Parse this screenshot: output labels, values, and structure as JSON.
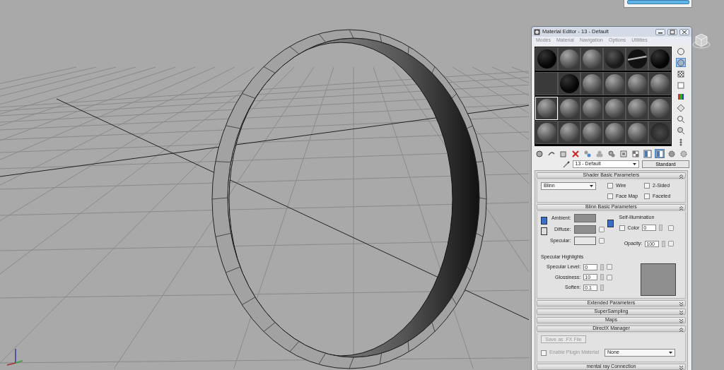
{
  "material_editor": {
    "title": "Material Editor - 13 - Default",
    "menu": [
      "Modes",
      "Material",
      "Navigation",
      "Options",
      "Utilities"
    ],
    "sample_slots": [
      {
        "kind": "black",
        "selected": false
      },
      {
        "kind": "sphere",
        "selected": false
      },
      {
        "kind": "sphere",
        "selected": false
      },
      {
        "kind": "dark",
        "selected": false
      },
      {
        "kind": "stripe",
        "selected": false
      },
      {
        "kind": "black",
        "selected": false
      },
      {
        "kind": "flat",
        "selected": false
      },
      {
        "kind": "black",
        "selected": false
      },
      {
        "kind": "sphere",
        "selected": false
      },
      {
        "kind": "sphere",
        "selected": false
      },
      {
        "kind": "sphere",
        "selected": false
      },
      {
        "kind": "sphere",
        "selected": false
      },
      {
        "kind": "sphere",
        "selected": true
      },
      {
        "kind": "sphere",
        "selected": false
      },
      {
        "kind": "sphere",
        "selected": false
      },
      {
        "kind": "sphere",
        "selected": false
      },
      {
        "kind": "sphere",
        "selected": false
      },
      {
        "kind": "sphere",
        "selected": false
      },
      {
        "kind": "sphere",
        "selected": false
      },
      {
        "kind": "sphere",
        "selected": false
      },
      {
        "kind": "sphere",
        "selected": false
      },
      {
        "kind": "sphere",
        "selected": false
      },
      {
        "kind": "sphere",
        "selected": false
      },
      {
        "kind": "glow",
        "selected": false
      }
    ],
    "side_toolbar": [
      {
        "on": false
      },
      {
        "on": true
      },
      {
        "on": false
      },
      {
        "on": false
      },
      {
        "on": false
      },
      {
        "on": false
      },
      {
        "on": false
      },
      {
        "on": false
      },
      {
        "on": false
      }
    ],
    "bottom_toolbar": [
      {
        "on": false
      },
      {
        "on": false
      },
      {
        "on": false
      },
      {
        "on": false
      },
      {
        "on": false
      },
      {
        "on": false
      },
      {
        "on": false
      },
      {
        "on": false
      },
      {
        "on": false
      },
      {
        "on": false
      },
      {
        "on": true
      },
      {
        "on": false
      },
      {
        "on": false
      }
    ],
    "material_name": "13 - Default",
    "material_type": "Standard",
    "rollouts": [
      {
        "kind": "shader",
        "title": "Shader Basic Parameters",
        "expanded": true,
        "shader": "Blinn",
        "checkboxes": [
          {
            "label": "Wire",
            "checked": false
          },
          {
            "label": "2-Sided",
            "checked": false
          },
          {
            "label": "Face Map",
            "checked": false
          },
          {
            "label": "Faceted",
            "checked": false
          }
        ]
      },
      {
        "kind": "blinn",
        "title": "Blinn Basic Parameters",
        "expanded": true,
        "swatches": [
          {
            "label": "Ambient:",
            "color": "#8e8e8e"
          },
          {
            "label": "Diffuse:",
            "color": "#8e8e8e"
          },
          {
            "label": "Specular:",
            "color": "#e6e6e6"
          }
        ],
        "self_illumination": {
          "title": "Self-Illumination",
          "checkbox": {
            "label": "Color",
            "checked": false
          },
          "value": "0"
        },
        "opacity": {
          "label": "Opacity:",
          "value": "100"
        },
        "highlights_title": "Specular Highlights",
        "fields": [
          {
            "label": "Specular Level:",
            "value": "0"
          },
          {
            "label": "Glossiness:",
            "value": "10"
          },
          {
            "label": "Soften:",
            "value": "0.1"
          }
        ]
      },
      {
        "kind": "collapsed",
        "title": "Extended Parameters",
        "expanded": false
      },
      {
        "kind": "collapsed",
        "title": "SuperSampling",
        "expanded": false
      },
      {
        "kind": "collapsed",
        "title": "Maps",
        "expanded": false
      },
      {
        "kind": "directx",
        "title": "DirectX Manager",
        "expanded": true,
        "button": "Save as .FX File",
        "checkbox": {
          "label": "Enable Plugin Material",
          "checked": false
        },
        "select": "None"
      },
      {
        "kind": "collapsed",
        "title": "mental ray Connection",
        "expanded": false
      }
    ]
  }
}
